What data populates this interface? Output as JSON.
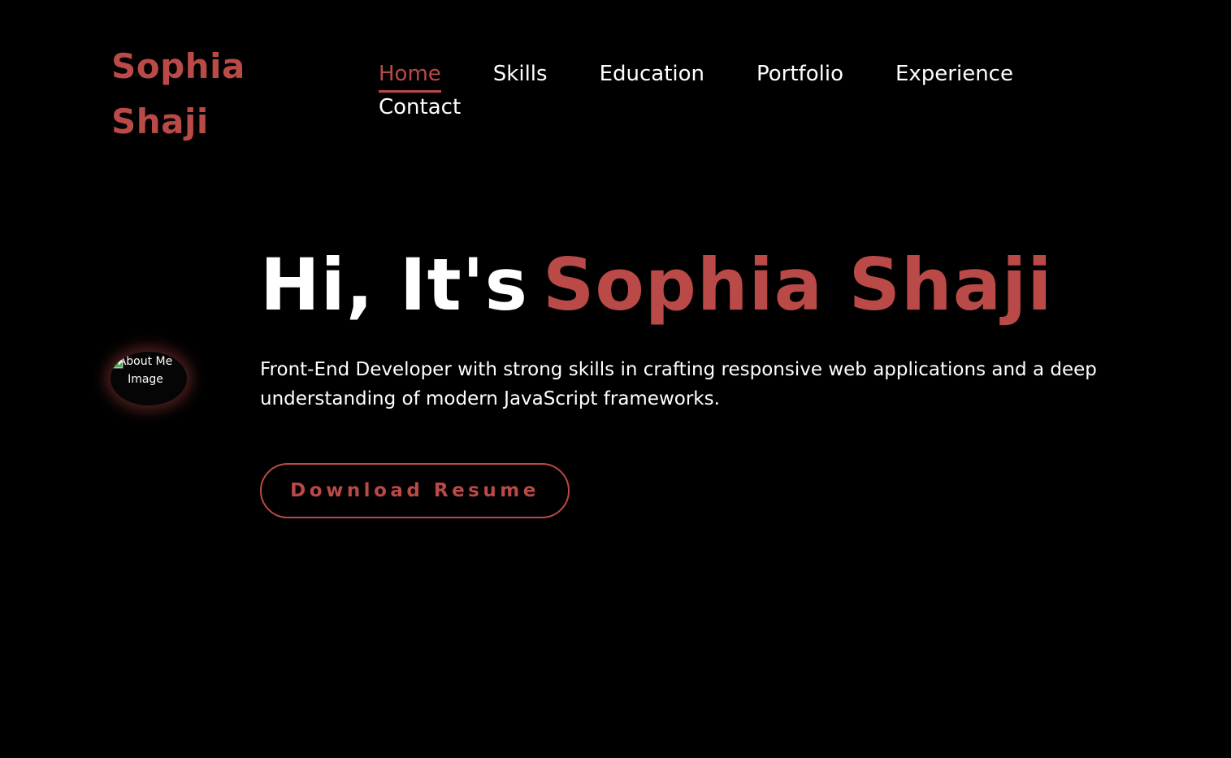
{
  "colors": {
    "accent": "#b94a48",
    "background": "#000000",
    "text": "#ffffff"
  },
  "logo": {
    "line1": "Sophia",
    "line2": "Shaji"
  },
  "nav": {
    "items": [
      {
        "label": "Home",
        "active": true
      },
      {
        "label": "Skills",
        "active": false
      },
      {
        "label": "Education",
        "active": false
      },
      {
        "label": "Portfolio",
        "active": false
      },
      {
        "label": "Experience",
        "active": false
      },
      {
        "label": "Contact",
        "active": false
      }
    ]
  },
  "hero": {
    "greeting": "Hi, It's",
    "name": "Sophia Shaji",
    "description": "Front-End Developer with strong skills in crafting responsive web applications and a deep understanding of modern JavaScript frameworks.",
    "image_alt": "About Me Image",
    "image_icon": "broken-image-icon",
    "resume_button": "Download Resume"
  }
}
